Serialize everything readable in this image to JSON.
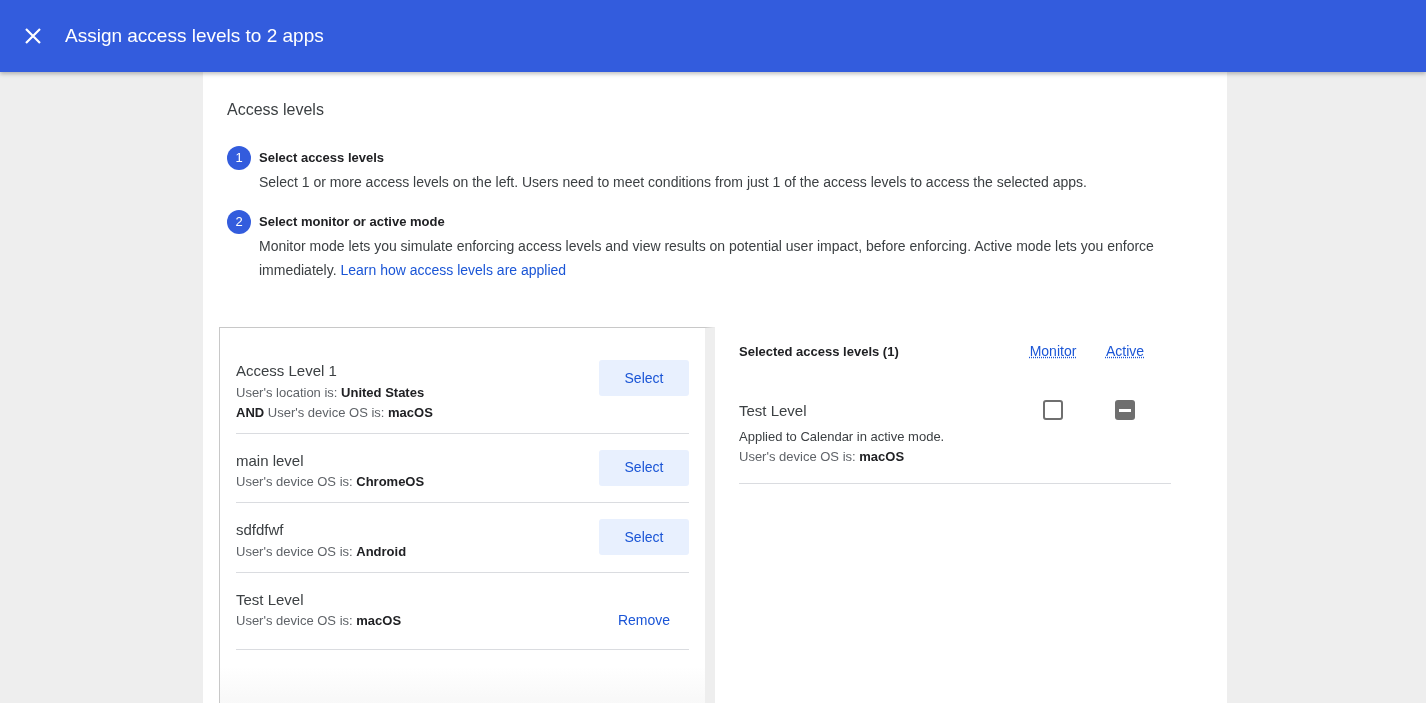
{
  "header": {
    "title": "Assign access levels to 2 apps"
  },
  "section_title": "Access levels",
  "steps": [
    {
      "number": "1",
      "title": "Select access levels",
      "text": "Select 1 or more access levels on the left. Users need to meet conditions from just 1 of the access levels to access the selected apps."
    },
    {
      "number": "2",
      "title": "Select monitor or active mode",
      "text": "Monitor mode lets you simulate enforcing access levels and view results on potential user impact, before enforcing. Active mode lets you enforce immediately.",
      "link": "Learn how access levels are applied"
    }
  ],
  "available_levels": [
    {
      "name": "Access Level 1",
      "conditions": [
        "User's location is: **United States**",
        "**AND**  User's device OS is: **macOS**"
      ],
      "action": "Select",
      "selected": false
    },
    {
      "name": "main level",
      "conditions": [
        "User's device OS is: **ChromeOS**"
      ],
      "action": "Select",
      "selected": false
    },
    {
      "name": "sdfdfwf",
      "conditions": [
        "User's device OS is: **Android**"
      ],
      "action": "Select",
      "selected": false
    },
    {
      "name": "Test Level",
      "conditions": [
        "User's device OS is: **macOS**"
      ],
      "action": "Remove",
      "selected": true
    }
  ],
  "selected_panel": {
    "title": "Selected access levels (1)",
    "columns": [
      "Monitor",
      "Active"
    ],
    "rows": [
      {
        "name": "Test Level",
        "note": "Applied to Calendar in active mode.",
        "conditions": [
          "User's device OS is: **macOS**"
        ],
        "monitor": {
          "checked": false
        },
        "active": {
          "indeterminate": true
        }
      }
    ]
  }
}
